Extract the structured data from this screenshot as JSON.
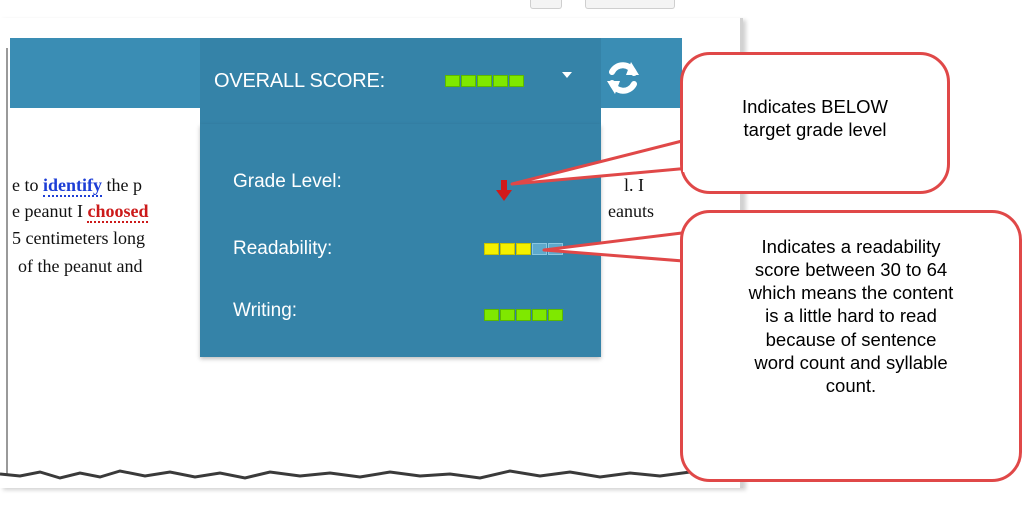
{
  "header": {
    "overall_score_label": "OVERALL SCORE:",
    "overall_score_fraction": 1.0,
    "dropdown_icon": "chevron-down-icon",
    "refresh_icon": "refresh-icon"
  },
  "document": {
    "line1_prefix": "e to ",
    "line1_word": "identify",
    "line1_mid": " the p",
    "line1_tail": "l. I",
    "line2_prefix": "e peanut I ",
    "line2_word": "choosed",
    "line2_tail": "eanuts",
    "line3": "5 centimeters long",
    "line4": "of the peanut and"
  },
  "score_panel": {
    "grade_level_label": "Grade Level:",
    "grade_level_indicator": "down-arrow-icon",
    "readability_label": "Readability:",
    "readability_fraction": 0.6,
    "writing_label": "Writing:",
    "writing_fraction": 1.0
  },
  "callouts": {
    "grade_level": [
      "Indicates BELOW",
      "target grade level"
    ],
    "readability": [
      "Indicates a readability",
      "score between 30 to 64",
      "which means the content",
      "is a little hard to read",
      "because of sentence",
      "word count and syllable",
      "count."
    ]
  },
  "colors": {
    "header_blue": "#3a8db4",
    "panel_blue": "#3583a8",
    "meter_green": "#7fe800",
    "meter_yellow": "#f4f000",
    "callout_border": "#e04848",
    "arrow_red": "#d11a1a"
  }
}
